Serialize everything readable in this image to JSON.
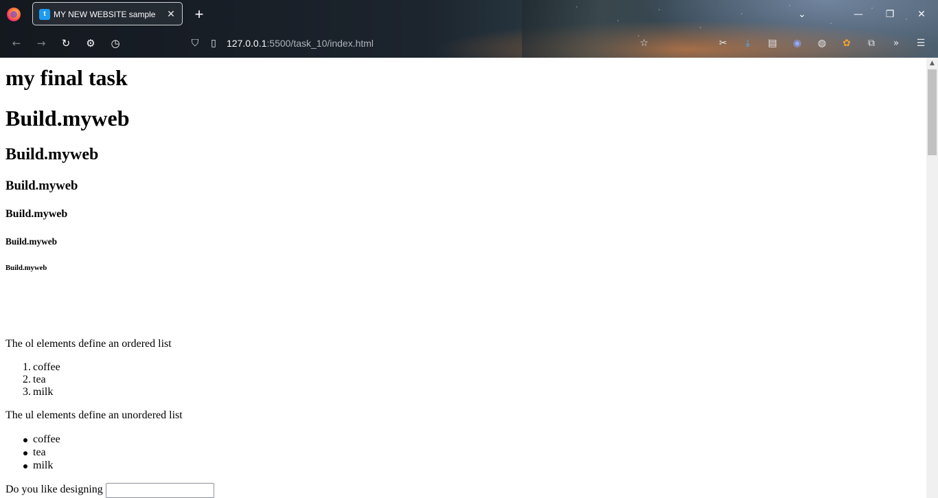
{
  "browser": {
    "tab": {
      "title": "MY NEW WEBSITE sample",
      "favicon": "twitter-bird-icon"
    },
    "url": {
      "host": "127.0.0.1",
      "rest": ":5500/task_10/index.html"
    },
    "icons": {
      "back": "←",
      "forward": "→",
      "reload": "↻",
      "settings": "⚙",
      "history": "◷",
      "shield": "⛉",
      "page": "▯",
      "star": "☆",
      "tab_list": "⌄",
      "minimize": "—",
      "restore": "❐",
      "close": "✕",
      "new_tab": "+",
      "tab_close": "✕",
      "screenshot": "✂",
      "download": "⤓",
      "reader": "▤",
      "extension1": "◉",
      "cookie": "◍",
      "extension2": "✿",
      "puzzle": "⧉",
      "overflow": "»",
      "menu": "☰"
    }
  },
  "page": {
    "h1_title": "my final task",
    "h1": "Build.myweb",
    "h2": "Build.myweb",
    "h3": "Build.myweb",
    "h4": "Build.myweb",
    "h5": "Build.myweb",
    "h6": "Build.myweb",
    "ol_intro": "The ol elements define an ordered list",
    "ol_items": [
      {
        "marker": "1.",
        "text": "coffee"
      },
      {
        "marker": "2.",
        "text": "tea"
      },
      {
        "marker": "3.",
        "text": "milk"
      }
    ],
    "ul_intro": "The ul elements define an unordered list",
    "ul_items": [
      "coffee",
      "tea",
      "milk"
    ],
    "question_label": "Do you like designing",
    "question_value": ""
  },
  "scrollbar": {
    "up_arrow": "▲"
  }
}
